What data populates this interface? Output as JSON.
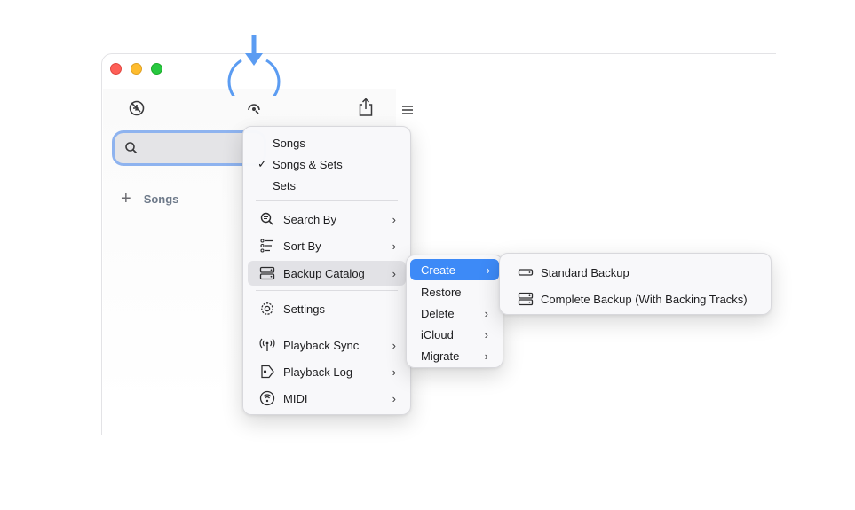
{
  "sidebar": {
    "add_label": "Songs"
  },
  "main_menu": {
    "items": [
      {
        "label": "Songs",
        "checked": false
      },
      {
        "label": "Songs & Sets",
        "checked": true
      },
      {
        "label": "Sets",
        "checked": false
      },
      {
        "label": "Search By",
        "icon": "search-list-icon",
        "submenu": true
      },
      {
        "label": "Sort By",
        "icon": "sort-list-icon",
        "submenu": true
      },
      {
        "label": "Backup Catalog",
        "icon": "backup-drive-icon",
        "submenu": true,
        "highlighted": true
      },
      {
        "label": "Settings",
        "icon": "gear-icon",
        "submenu": false
      },
      {
        "label": "Playback Sync",
        "icon": "antenna-icon",
        "submenu": true
      },
      {
        "label": "Playback Log",
        "icon": "playback-log-icon",
        "submenu": true
      },
      {
        "label": "MIDI",
        "icon": "midi-icon",
        "submenu": true
      }
    ],
    "check_glyph": "✓",
    "chevron_glyph": "›"
  },
  "backup_menu": {
    "items": [
      {
        "label": "Create",
        "submenu": true,
        "active": true
      },
      {
        "label": "Restore",
        "submenu": false
      },
      {
        "label": "Delete",
        "submenu": true
      },
      {
        "label": "iCloud",
        "submenu": true
      },
      {
        "label": "Migrate",
        "submenu": true
      }
    ]
  },
  "create_menu": {
    "items": [
      {
        "label": "Standard Backup",
        "icon": "single-drive-icon"
      },
      {
        "label": "Complete Backup (With Backing Tracks)",
        "icon": "dual-drive-icon"
      }
    ]
  },
  "colors": {
    "accent": "#3d8af7",
    "annotation": "#5b9cf2",
    "search_focus": "#8eb3ef"
  }
}
